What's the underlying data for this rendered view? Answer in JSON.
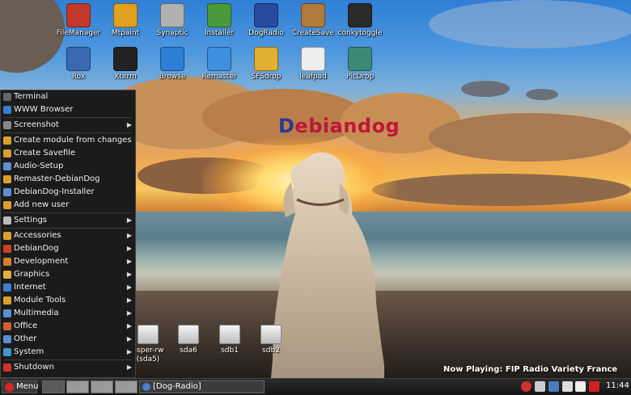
{
  "desktop": {
    "icons_row1": [
      {
        "label": "FileManager",
        "icon": "file-manager-icon",
        "color": "#c0392b"
      },
      {
        "label": "Mtpaint",
        "icon": "paint-icon",
        "color": "#e0a020"
      },
      {
        "label": "Synaptic",
        "icon": "package-manager-icon",
        "color": "#b0b0b0"
      },
      {
        "label": "Installer",
        "icon": "installer-icon",
        "color": "#4a9a3a"
      },
      {
        "label": "DogRadio",
        "icon": "radio-icon",
        "color": "#2a4aa0"
      },
      {
        "label": "CreateSave",
        "icon": "save-box-icon",
        "color": "#b07a3a"
      },
      {
        "label": "conkytoggle",
        "icon": "monitor-icon",
        "color": "#2a2a2a"
      }
    ],
    "icons_row2": [
      {
        "label": "Rox",
        "icon": "gear-icon",
        "color": "#3a6ab0"
      },
      {
        "label": "Xterm",
        "icon": "terminal-icon",
        "color": "#222222"
      },
      {
        "label": "Browse",
        "icon": "compass-icon",
        "color": "#2f7fd6"
      },
      {
        "label": "Remaster",
        "icon": "remaster-icon",
        "color": "#3f8fe0"
      },
      {
        "label": "SFSdrop",
        "icon": "sfs-package-icon",
        "color": "#e0b030"
      },
      {
        "label": "leafpad",
        "icon": "notepad-icon",
        "color": "#eeeeee"
      },
      {
        "label": "PicDrop",
        "icon": "picture-icon",
        "color": "#3a8a7a"
      }
    ],
    "drives": [
      {
        "label": "asper-rw",
        "sub": "(sda5)",
        "icon": "hard-drive-icon"
      },
      {
        "label": "sda6",
        "sub": "",
        "icon": "hard-drive-icon"
      },
      {
        "label": "sdb1",
        "sub": "",
        "icon": "usb-drive-icon"
      },
      {
        "label": "sdb2",
        "sub": "",
        "icon": "usb-drive-icon"
      }
    ],
    "logo_part1": "D",
    "logo_part2": "ebiandog",
    "now_playing": "Now Playing: FIP Radio Variety France"
  },
  "menu": {
    "items": [
      {
        "label": "Terminal",
        "icon": "terminal-icon",
        "color": "#666666",
        "submenu": false
      },
      {
        "label": "WWW Browser",
        "icon": "browser-icon",
        "color": "#3a7fd0",
        "submenu": false
      },
      {
        "sep": true
      },
      {
        "label": "Screenshot",
        "icon": "camera-icon",
        "color": "#888888",
        "submenu": true
      },
      {
        "sep": true
      },
      {
        "label": "Create module from changes",
        "icon": "lock-icon",
        "color": "#d9a030",
        "submenu": false
      },
      {
        "label": "Create Savefile",
        "icon": "lock-icon",
        "color": "#d9a030",
        "submenu": false
      },
      {
        "label": "Audio-Setup",
        "icon": "audio-icon",
        "color": "#5a8fd0",
        "submenu": false
      },
      {
        "label": "Remaster-DebianDog",
        "icon": "lock-icon",
        "color": "#d9a030",
        "submenu": false
      },
      {
        "label": "DebianDog-Installer",
        "icon": "installer-icon",
        "color": "#5a8fd0",
        "submenu": false
      },
      {
        "label": "Add new user",
        "icon": "lock-icon",
        "color": "#d9a030",
        "submenu": false
      },
      {
        "sep": true
      },
      {
        "label": "Settings",
        "icon": "wrench-icon",
        "color": "#bbbbbb",
        "submenu": true
      },
      {
        "sep": true
      },
      {
        "label": "Accessories",
        "icon": "accessories-icon",
        "color": "#d9a030",
        "submenu": true
      },
      {
        "label": "DebianDog",
        "icon": "debiandog-icon",
        "color": "#d04020",
        "submenu": true
      },
      {
        "label": "Development",
        "icon": "development-icon",
        "color": "#d08030",
        "submenu": true
      },
      {
        "label": "Graphics",
        "icon": "graphics-icon",
        "color": "#e0b040",
        "submenu": true
      },
      {
        "label": "Internet",
        "icon": "internet-icon",
        "color": "#3a7fd0",
        "submenu": true
      },
      {
        "label": "Module Tools",
        "icon": "lock-icon",
        "color": "#d9a030",
        "submenu": true
      },
      {
        "label": "Multimedia",
        "icon": "multimedia-icon",
        "color": "#5a8fd0",
        "submenu": true
      },
      {
        "label": "Office",
        "icon": "office-icon",
        "color": "#d06030",
        "submenu": true
      },
      {
        "label": "Other",
        "icon": "other-icon",
        "color": "#5a8fd0",
        "submenu": true
      },
      {
        "label": "System",
        "icon": "system-icon",
        "color": "#3a9ad0",
        "submenu": true
      },
      {
        "sep": true
      },
      {
        "label": "Shutdown",
        "icon": "shutdown-icon",
        "color": "#d03030",
        "submenu": true
      }
    ]
  },
  "taskbar": {
    "menu_label": "Menu",
    "task_label": "[Dog-Radio]",
    "clock": "11:44",
    "tray": [
      {
        "icon": "stop-icon",
        "color": "#d03030"
      },
      {
        "icon": "no-entry-icon",
        "color": "#cccccc"
      },
      {
        "icon": "network-icon",
        "color": "#4a7ac0"
      },
      {
        "icon": "battery-icon",
        "color": "#dddddd"
      },
      {
        "icon": "volume-icon",
        "color": "#eeeeee"
      },
      {
        "icon": "flag-icon",
        "color": "#d02020"
      }
    ]
  }
}
